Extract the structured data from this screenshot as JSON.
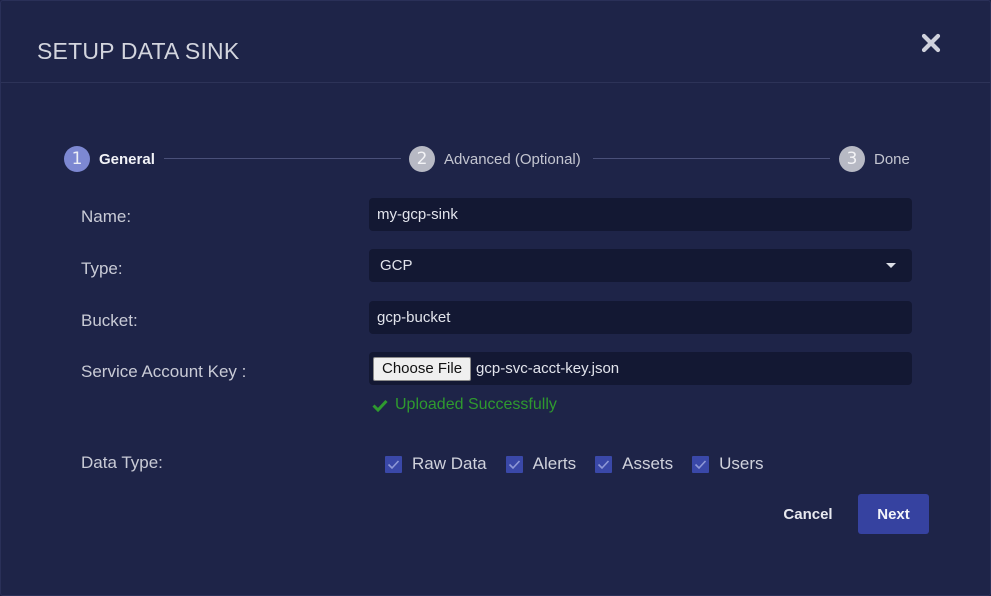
{
  "modal": {
    "title": "SETUP DATA SINK",
    "close_icon": "close-x-icon"
  },
  "stepper": {
    "steps": [
      {
        "number": "1",
        "label": "General",
        "state": "active"
      },
      {
        "number": "2",
        "label": "Advanced (Optional)",
        "state": "inactive"
      },
      {
        "number": "3",
        "label": "Done",
        "state": "inactive"
      }
    ]
  },
  "form": {
    "name": {
      "label": "Name:",
      "value": "my-gcp-sink"
    },
    "type": {
      "label": "Type:",
      "value": "GCP"
    },
    "bucket": {
      "label": "Bucket:",
      "value": "gcp-bucket"
    },
    "service_account_key": {
      "label": "Service Account Key :",
      "button_label": "Choose File",
      "file_name": "gcp-svc-acct-key.json",
      "status": "Uploaded Successfully"
    },
    "data_type": {
      "label": "Data Type:",
      "options": [
        {
          "label": "Raw Data",
          "checked": true
        },
        {
          "label": "Alerts",
          "checked": true
        },
        {
          "label": "Assets",
          "checked": true
        },
        {
          "label": "Users",
          "checked": true
        }
      ]
    }
  },
  "actions": {
    "cancel_label": "Cancel",
    "next_label": "Next"
  },
  "colors": {
    "background": "#1e2448",
    "input_background": "#131833",
    "primary": "#3642a0",
    "step_active": "#7d88d2",
    "success": "#2f9a2f"
  }
}
